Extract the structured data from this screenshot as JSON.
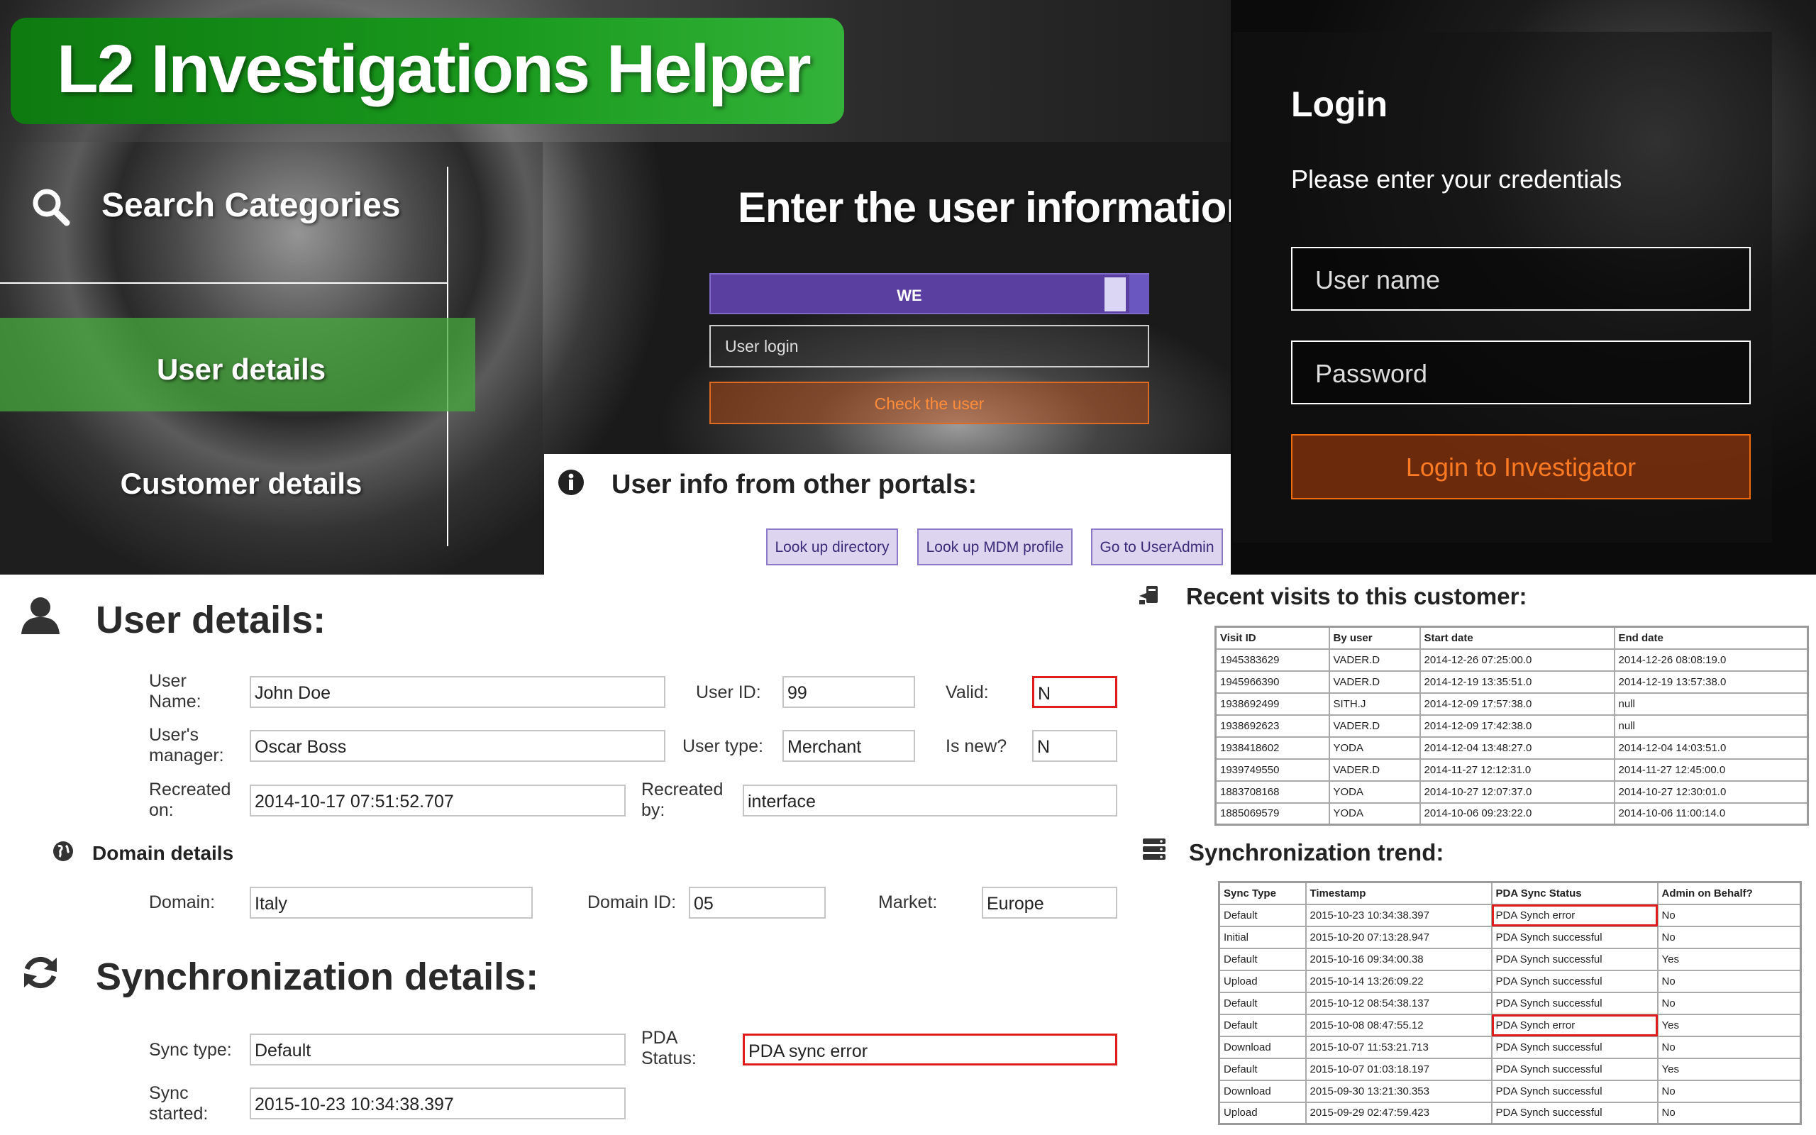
{
  "app_title": "L2 Investigations Helper",
  "sidebar": {
    "title": "Search Categories",
    "items": [
      {
        "label": "User details",
        "active": true
      },
      {
        "label": "Customer details",
        "active": false
      }
    ]
  },
  "user_lookup": {
    "heading": "Enter the user information",
    "region_selector": "WE",
    "login_placeholder": "User login",
    "check_button": "Check the user"
  },
  "portals": {
    "title": "User info from other portals:",
    "buttons": [
      "Look up directory",
      "Look up MDM profile",
      "Go to UserAdmin"
    ]
  },
  "login": {
    "title": "Login",
    "subtitle": "Please enter your credentials",
    "username_placeholder": "User name",
    "password_placeholder": "Password",
    "button": "Login to Investigator"
  },
  "user_details": {
    "heading": "User details:",
    "user_name_label": "User Name:",
    "user_name": "John Doe",
    "user_id_label": "User ID:",
    "user_id": "99",
    "valid_label": "Valid:",
    "valid": "N",
    "manager_label": "User's manager:",
    "manager": "Oscar Boss",
    "user_type_label": "User type:",
    "user_type": "Merchant",
    "is_new_label": "Is new?",
    "is_new": "N",
    "recreated_on_label": "Recreated on:",
    "recreated_on": "2014-10-17 07:51:52.707",
    "recreated_by_label": "Recreated by:",
    "recreated_by": "interface"
  },
  "domain_details": {
    "heading": "Domain details",
    "domain_label": "Domain:",
    "domain": "Italy",
    "domain_id_label": "Domain ID:",
    "domain_id": "05",
    "market_label": "Market:",
    "market": "Europe"
  },
  "sync_details": {
    "heading": "Synchronization details:",
    "sync_type_label": "Sync type:",
    "sync_type": "Default",
    "pda_status_label": "PDA Status:",
    "pda_status": "PDA sync error",
    "sync_started_label": "Sync started:",
    "sync_started": "2015-10-23 10:34:38.397"
  },
  "recent_visits": {
    "heading": "Recent visits to this customer:",
    "columns": [
      "Visit ID",
      "By user",
      "Start date",
      "End date"
    ],
    "rows": [
      [
        "1945383629",
        "VADER.D",
        "2014-12-26 07:25:00.0",
        "2014-12-26 08:08:19.0"
      ],
      [
        "1945966390",
        "VADER.D",
        "2014-12-19 13:35:51.0",
        "2014-12-19 13:57:38.0"
      ],
      [
        "1938692499",
        "SITH.J",
        "2014-12-09 17:57:38.0",
        "null"
      ],
      [
        "1938692623",
        "VADER.D",
        "2014-12-09 17:42:38.0",
        "null"
      ],
      [
        "1938418602",
        "YODA",
        "2014-12-04 13:48:27.0",
        "2014-12-04 14:03:51.0"
      ],
      [
        "1939749550",
        "VADER.D",
        "2014-11-27 12:12:31.0",
        "2014-11-27 12:45:00.0"
      ],
      [
        "1883708168",
        "YODA",
        "2014-10-27 12:07:37.0",
        "2014-10-27 12:30:01.0"
      ],
      [
        "1885069579",
        "YODA",
        "2014-10-06 09:23:22.0",
        "2014-10-06 11:00:14.0"
      ]
    ]
  },
  "sync_trend": {
    "heading": "Synchronization trend:",
    "columns": [
      "Sync Type",
      "Timestamp",
      "PDA Sync Status",
      "Admin on Behalf?"
    ],
    "rows": [
      [
        "Default",
        "2015-10-23 10:34:38.397",
        "PDA Synch error",
        "No"
      ],
      [
        "Initial",
        "2015-10-20 07:13:28.947",
        "PDA Synch successful",
        "No"
      ],
      [
        "Default",
        "2015-10-16 09:34:00.38",
        "PDA Synch successful",
        "Yes"
      ],
      [
        "Upload",
        "2015-10-14 13:26:09.22",
        "PDA Synch successful",
        "No"
      ],
      [
        "Default",
        "2015-10-12 08:54:38.137",
        "PDA Synch successful",
        "No"
      ],
      [
        "Default",
        "2015-10-08 08:47:55.12",
        "PDA Synch error",
        "Yes"
      ],
      [
        "Download",
        "2015-10-07 11:53:21.713",
        "PDA Synch successful",
        "No"
      ],
      [
        "Default",
        "2015-10-07 01:03:18.197",
        "PDA Synch successful",
        "Yes"
      ],
      [
        "Download",
        "2015-09-30 13:21:30.353",
        "PDA Synch successful",
        "No"
      ],
      [
        "Upload",
        "2015-09-29 02:47:59.423",
        "PDA Synch successful",
        "No"
      ]
    ]
  },
  "colors": {
    "error_outline": "#e01c1c",
    "accent_green": "#1a9a1e",
    "accent_orange": "#f06a10",
    "accent_purple": "#5a3fa0"
  }
}
